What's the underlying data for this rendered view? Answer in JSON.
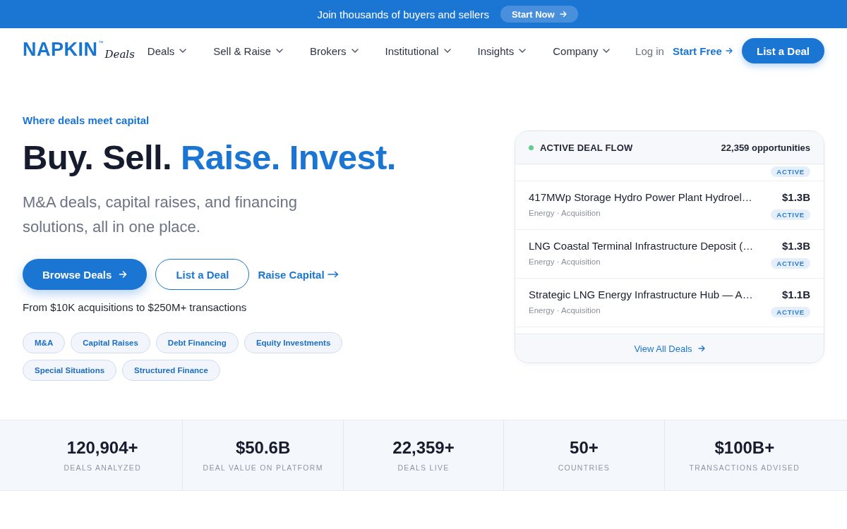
{
  "announcement": {
    "text": "Join thousands of buyers and sellers",
    "button": "Start Now"
  },
  "nav": {
    "logo": {
      "name": "NAPKIN",
      "trademark": "™",
      "product": "Deals"
    },
    "items": [
      {
        "label": "Deals",
        "dropdown": true
      },
      {
        "label": "Sell & Raise",
        "dropdown": true
      },
      {
        "label": "Brokers",
        "dropdown": true
      },
      {
        "label": "Institutional",
        "dropdown": true
      },
      {
        "label": "Insights",
        "dropdown": true
      },
      {
        "label": "Company",
        "dropdown": true
      }
    ],
    "login": "Log in",
    "start_free": "Start Free",
    "cta": "List a Deal"
  },
  "hero": {
    "eyebrow": "Where deals meet capital",
    "headline": [
      {
        "text": "Buy. Sell.",
        "accent": false
      },
      {
        "text": "Raise. Invest.",
        "accent": true
      }
    ],
    "subtitle": "M&A deals, capital raises, and financing solutions, all in one place.",
    "buttons": [
      {
        "kind": "primary",
        "label": "Browse Deals"
      },
      {
        "kind": "outline",
        "label": "List a Deal"
      },
      {
        "kind": "link",
        "label": "Raise Capital"
      }
    ],
    "note": "From $10K acquisitions to $250M+ transactions",
    "tags": [
      "M&A",
      "Capital Raises",
      "Debt Financing",
      "Equity Investments",
      "Special Situations",
      "Structured Finance"
    ]
  },
  "deal_flow": {
    "live": true,
    "title": "ACTIVE DEAL FLOW",
    "count": "22,359 opportunities",
    "deals": [
      {
        "kind": "partial",
        "status": "ACTIVE"
      },
      {
        "kind": "full",
        "title": "417MWp Storage Hydro Power Plant Hydroel…",
        "meta": "Energy · Acquisition",
        "amount": "$1.3B",
        "status": "ACTIVE"
      },
      {
        "kind": "full",
        "title": "LNG Coastal Terminal Infrastructure Deposit (…",
        "meta": "Energy · Acquisition",
        "amount": "$1.3B",
        "status": "ACTIVE"
      },
      {
        "kind": "full",
        "title": "Strategic LNG Energy Infrastructure Hub — A…",
        "meta": "Energy · Acquisition",
        "amount": "$1.1B",
        "status": "ACTIVE"
      }
    ],
    "footer": "View All Deals"
  },
  "stats": [
    {
      "value": "120,904+",
      "label": "DEALS ANALYZED"
    },
    {
      "value": "$50.6B",
      "label": "DEAL VALUE ON PLATFORM"
    },
    {
      "value": "22,359+",
      "label": "DEALS LIVE"
    },
    {
      "value": "50+",
      "label": "COUNTRIES"
    },
    {
      "value": "$100B+",
      "label": "TRANSACTIONS ADVISED"
    }
  ]
}
